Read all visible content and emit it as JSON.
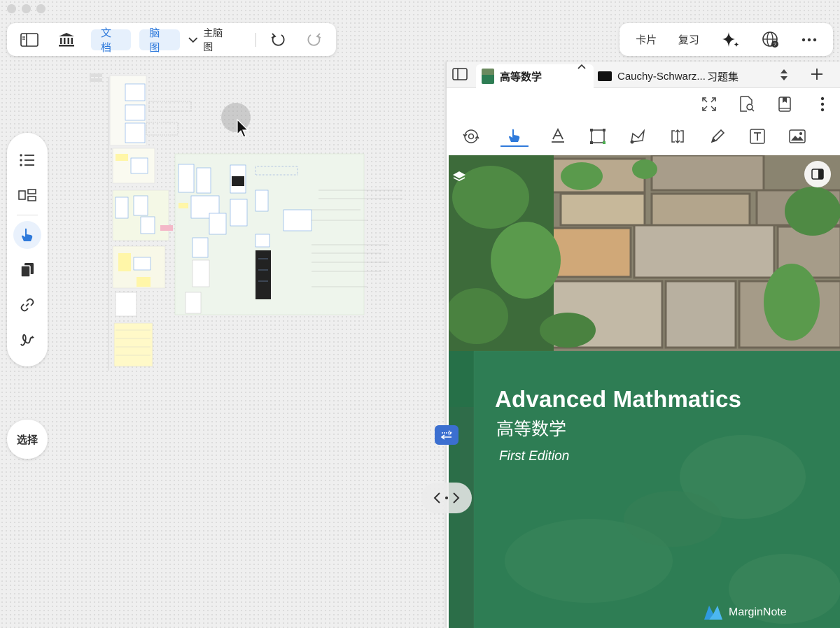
{
  "toolbar": {
    "doc_label": "文档",
    "mindmap_label": "脑图",
    "main_map_label": "主脑图"
  },
  "toolbar_right": {
    "cards_label": "卡片",
    "review_label": "复习"
  },
  "sidebar": {
    "select_label": "选择"
  },
  "doc_tabs": [
    {
      "title": "高等数学"
    },
    {
      "title": "Cauchy-Schwarz..."
    },
    {
      "title": "习题集"
    }
  ],
  "cover": {
    "title": "Advanced Mathmatics",
    "subtitle": "高等数学",
    "edition": "First Edition",
    "brand": "MarginNote"
  },
  "colors": {
    "accent": "#2f7adb",
    "cover_green": "#2e7d54"
  }
}
